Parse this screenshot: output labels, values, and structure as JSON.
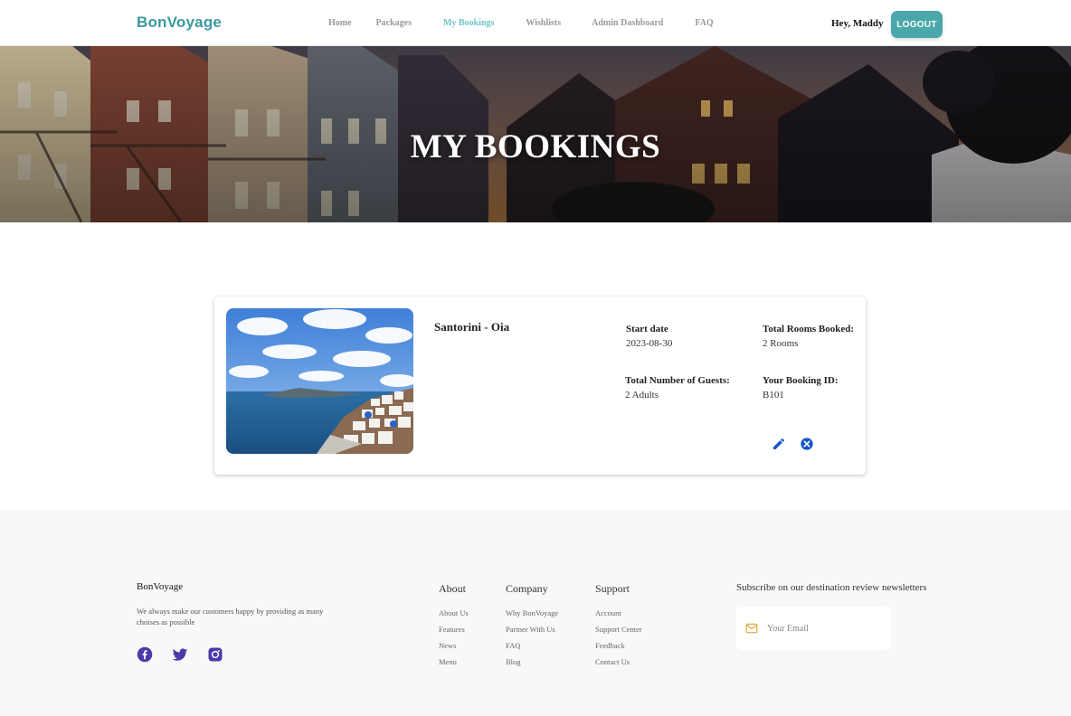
{
  "navbar": {
    "brand": "BonVoyage",
    "links": [
      "Home",
      "Packages",
      "My Bookings",
      "Wishlists",
      "Admin Dashboard",
      "FAQ"
    ],
    "active_link": "My Bookings",
    "greeting": "Hey, Maddy",
    "logout_label": "LOGOUT"
  },
  "hero": {
    "title": "MY BOOKINGS"
  },
  "booking": {
    "destination": "Santorini - Oia",
    "start_date_label": "Start date",
    "start_date": "2023-08-30",
    "rooms_label": "Total Rooms Booked:",
    "rooms": "2 Rooms",
    "guests_label": "Total Number of Guests:",
    "guests": "2 Adults",
    "booking_id_label": "Your Booking ID:",
    "booking_id": "B101",
    "edit_icon": "pencil-icon",
    "cancel_icon": "close-circle-icon"
  },
  "footer": {
    "brand": "BonVoyage",
    "description": "We always make our customers happy by providing as many choises as possible",
    "social": [
      "facebook-icon",
      "twitter-icon",
      "instagram-icon"
    ],
    "columns": [
      {
        "title": "About",
        "links": [
          "About Us",
          "Features",
          "News",
          "Menu"
        ]
      },
      {
        "title": "Company",
        "links": [
          "Why BonVoyage",
          "Partner With Us",
          "FAQ",
          "Blog"
        ]
      },
      {
        "title": "Support",
        "links": [
          "Account",
          "Support Center",
          "Feedback",
          "Contact Us"
        ]
      }
    ],
    "subscribe_title": "Subscribe on our destination review newsletters",
    "email_placeholder": "Your Email"
  },
  "colors": {
    "brand": "#3a9a9c",
    "active_link": "#6dc4c6",
    "logout_bg": "#4aa8aa",
    "action_icon": "#1a55c9",
    "social_icon": "#4b3aa8",
    "mail_icon": "#e0a536"
  }
}
